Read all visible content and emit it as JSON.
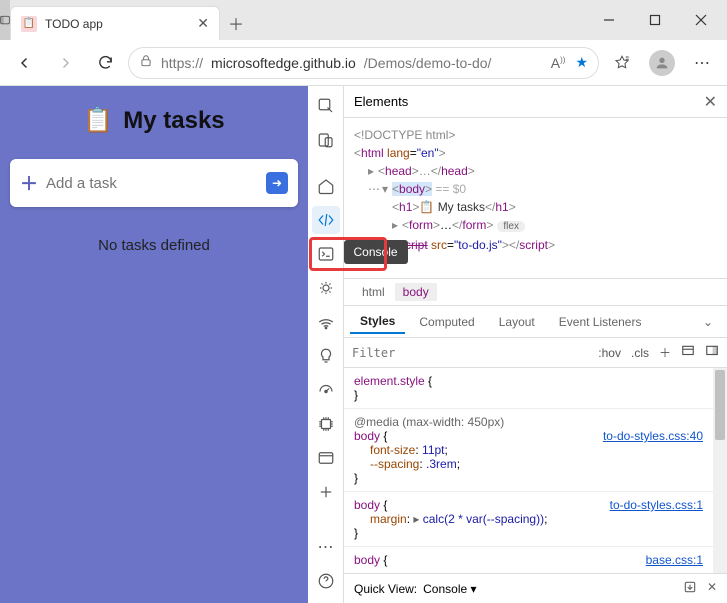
{
  "browser": {
    "tab_title": "TODO app",
    "url": {
      "prefix": "https://",
      "domain": "microsoftedge.github.io",
      "path": "/Demos/demo-to-do/"
    }
  },
  "app": {
    "title": "My tasks",
    "input_placeholder": "Add a task",
    "empty_text": "No tasks defined"
  },
  "devtools": {
    "panel_title": "Elements",
    "console_tooltip": "Console",
    "dom": {
      "doctype": "<!DOCTYPE html>",
      "html_open": "html",
      "html_lang_attr": "lang",
      "html_lang_val": "\"en\"",
      "head": "head",
      "body": "body",
      "body_hint": "== $0",
      "h1": "h1",
      "h1_text": "My tasks",
      "h1_emoji": "📋",
      "form": "form",
      "form_pill": "flex",
      "script": "script",
      "script_src_attr": "src",
      "script_src_val": "\"to-do.js\"",
      "ellipsis": "…"
    },
    "breadcrumb": {
      "html": "html",
      "body": "body"
    },
    "styles": {
      "tabs": [
        "Styles",
        "Computed",
        "Layout",
        "Event Listeners"
      ],
      "filter_placeholder": "Filter",
      "hov": ":hov",
      "cls": ".cls",
      "rules": [
        {
          "selector": "element.style",
          "props": []
        },
        {
          "media": "@media (max-width: 450px)",
          "selector": "body",
          "link": "to-do-styles.css:40",
          "props": [
            {
              "name": "font-size",
              "value": "11pt"
            },
            {
              "name": "--spacing",
              "value": ".3rem"
            }
          ]
        },
        {
          "selector": "body",
          "link": "to-do-styles.css:1",
          "props": [
            {
              "name": "margin",
              "value": "calc(2 * var(--spacing))",
              "expandable": true
            }
          ]
        },
        {
          "selector": "body",
          "link": "base.css:1",
          "props": []
        }
      ]
    },
    "quickview": {
      "label": "Quick View:",
      "value": "Console"
    }
  }
}
